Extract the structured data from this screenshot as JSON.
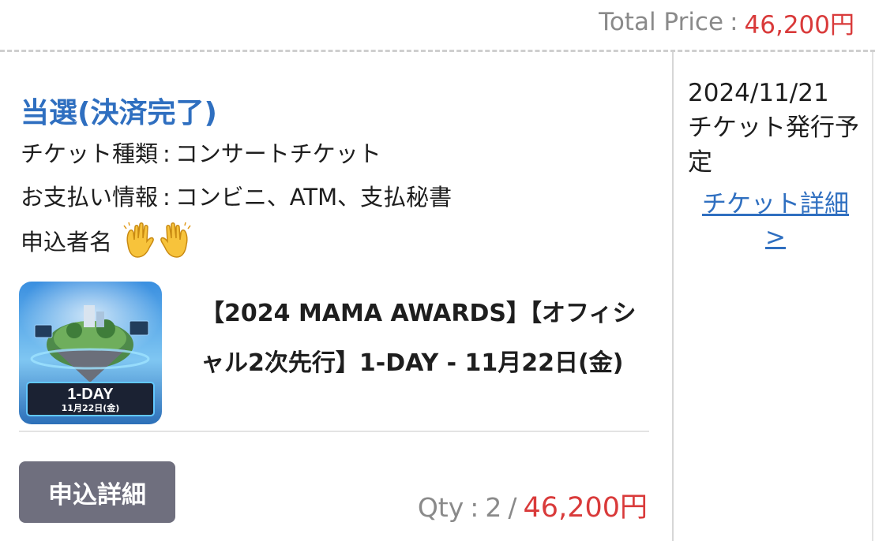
{
  "total": {
    "label": "Total Price",
    "separator": ":",
    "value": "46,200円"
  },
  "order": {
    "status": "当選(決済完了)",
    "ticket_type_label": "チケット種類",
    "ticket_type_value": "コンサートチケット",
    "payment_label": "お支払い情報",
    "payment_value": "コンビニ、ATM、支払秘書",
    "applicant_label": "申込者名",
    "colon": ":"
  },
  "event": {
    "title": "【2024 MAMA AWARDS】【オフィシャル2次先行】1-DAY - 11月22日(金)",
    "thumbnail_badge": "1-DAY",
    "thumbnail_date": "11月22日(金)"
  },
  "actions": {
    "detail_button": "申込詳細"
  },
  "quantity": {
    "label": "Qty",
    "separator": ":",
    "count": "2",
    "slash": "/",
    "price": "46,200円"
  },
  "side": {
    "date": "2024/11/21",
    "issue_text": "チケット発行予定",
    "detail_link_line1": "チケット詳細",
    "detail_link_line2": ">"
  },
  "colors": {
    "accent_blue": "#2f6fc0",
    "price_red": "#d93a3a",
    "button_gray": "#6f6f7e"
  },
  "icons": {
    "applicant_name_redaction": "raised-hands-emoji"
  }
}
